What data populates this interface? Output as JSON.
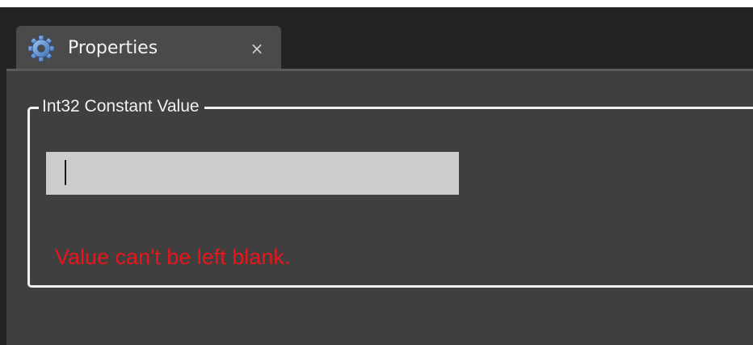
{
  "tab": {
    "title": "Properties",
    "close_glyph": "×",
    "icon": "gear-icon"
  },
  "group": {
    "legend": "Int32 Constant Value"
  },
  "value_field": {
    "value": ""
  },
  "validation": {
    "error_message": "Value can't be left blank."
  },
  "colors": {
    "window_background": "#222222",
    "tab_background": "#4a4a4a",
    "panel_background": "#3f3f3f",
    "input_background": "#cccccc",
    "error_text": "#e8161c"
  }
}
